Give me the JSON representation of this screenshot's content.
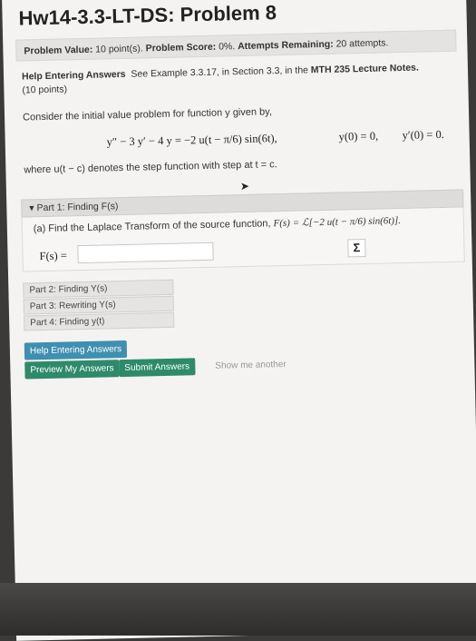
{
  "page": {
    "title": "Hw14-3.3-LT-DS: Problem 8"
  },
  "score": {
    "value_label": "Problem Value:",
    "value": "10 point(s).",
    "score_label": "Problem Score:",
    "score": "0%.",
    "attempts_label": "Attempts Remaining:",
    "attempts": "20 attempts."
  },
  "help": {
    "label": "Help Entering Answers",
    "text": "See Example 3.3.17, in Section 3.3, in the",
    "notes": "MTH 235 Lecture Notes.",
    "points": "(10 points)"
  },
  "problem": {
    "intro": "Consider the initial value problem for function y given by,",
    "equation": "y″ − 3 y′ − 4 y = −2 u(t − π/6) sin(6t),",
    "ic1": "y(0) = 0,",
    "ic2": "y′(0) = 0.",
    "step_note": "where u(t − c) denotes the step function with step at t = c."
  },
  "part1": {
    "header": "▾ Part 1: Finding F(s)",
    "question_prefix": "(a) Find the Laplace Transform of the source function,",
    "question_formula": "F(s) = ℒ[−2 u(t − π/6) sin(6t)].",
    "answer_label": "F(s) =",
    "answer_value": "",
    "sigma_label": "Σ"
  },
  "parts": [
    {
      "label": "Part 2: Finding Y(s)"
    },
    {
      "label": "Part 3: Rewriting Y(s)"
    },
    {
      "label": "Part 4: Finding y(t)"
    }
  ],
  "buttons": {
    "help": "Help Entering Answers",
    "preview": "Preview My Answers",
    "submit": "Submit Answers",
    "show_another": "Show me another"
  }
}
